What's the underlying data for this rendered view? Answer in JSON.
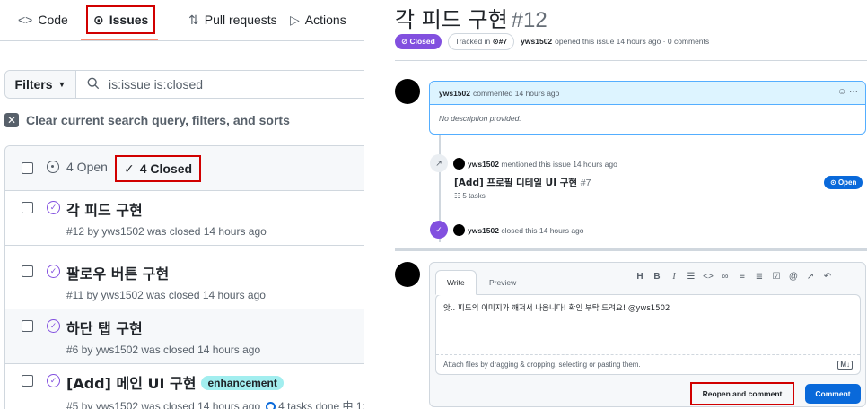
{
  "repo_nav": {
    "tabs": [
      {
        "label": "Code",
        "icon": "code-icon"
      },
      {
        "label": "Issues",
        "icon": "issue-open-icon"
      },
      {
        "label": "Pull requests",
        "icon": "git-pull-request-icon"
      },
      {
        "label": "Actions",
        "icon": "play-icon"
      }
    ],
    "selected": "Issues"
  },
  "filters": {
    "button_label": "Filters",
    "search_value": "is:issue is:closed"
  },
  "clear_query_label": "Clear current search query, filters, and sorts",
  "list_header": {
    "open_label": "4 Open",
    "closed_label": "4 Closed"
  },
  "issues": [
    {
      "title": "각 피드 구현",
      "meta": "#12 by yws1502 was closed 14 hours ago"
    },
    {
      "title": "팔로우 버튼 구현",
      "meta": "#11 by yws1502 was closed 14 hours ago"
    },
    {
      "title": "하단 탭 구현",
      "meta": "#6 by yws1502 was closed 14 hours ago"
    },
    {
      "title": "[Add] 메인 UI 구현",
      "label": "enhancement",
      "meta": "#5 by yws1502 was closed 14 hours ago",
      "tasks": "4 tasks done",
      "trail": "中 1:"
    }
  ],
  "issue_detail": {
    "title": "각 피드 구현",
    "number": "#12",
    "state_badge": "Closed",
    "tracked_prefix": "Tracked in",
    "tracked_ref": "#7",
    "author": "yws1502",
    "opened_text": "opened this issue 14 hours ago · 0 comments",
    "first_comment": {
      "author": "yws1502",
      "header_text": "commented 14 hours ago",
      "body": "No description provided."
    },
    "timeline": {
      "mention_author": "yws1502",
      "mention_text": "mentioned this issue 14 hours ago",
      "ref_title": "[Add] 프로필 디테일 UI 구현",
      "ref_number": "#7",
      "ref_tasks": "5 tasks",
      "ref_state": "Open",
      "closed_author": "yws1502",
      "closed_text": "closed this 14 hours ago"
    },
    "editor": {
      "tab_write": "Write",
      "tab_preview": "Preview",
      "toolbar": [
        "H",
        "B",
        "I",
        "quote",
        "code",
        "link",
        "ul",
        "ol",
        "task",
        "@",
        "ref",
        "reply"
      ],
      "text": "앗.. 피드의 이미지가 깨져서 나옵니다! 확인 부탁 드려요! @yws1502",
      "attach_hint": "Attach files by dragging & dropping, selecting or pasting them.",
      "reopen_button": "Reopen and comment",
      "comment_button": "Comment"
    }
  },
  "colors": {
    "accent_closed": "#8250df",
    "accent_open": "#0969da",
    "highlight_box": "#d10000",
    "label_enhancement": "#a2eeef"
  }
}
